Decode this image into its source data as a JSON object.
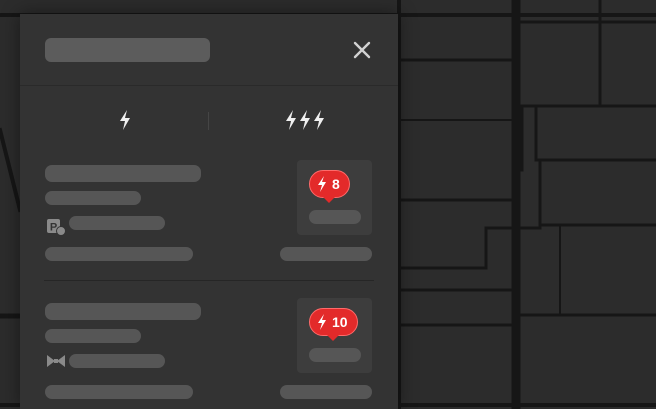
{
  "panel": {
    "tabs": [
      {
        "icon": "single-bolt-icon"
      },
      {
        "icon": "triple-bolt-icon"
      }
    ],
    "close_icon": "close-icon"
  },
  "stations": [
    {
      "available_stalls": "8",
      "amenity_icon": "parking-fee-icon"
    },
    {
      "available_stalls": "10",
      "amenity_icon": "bowtie-icon"
    }
  ],
  "colors": {
    "badge": "#e32a2a",
    "panel": "#333333",
    "map_background": "#2b2b2b",
    "map_roads": "#151515",
    "skeleton": "#565656"
  }
}
